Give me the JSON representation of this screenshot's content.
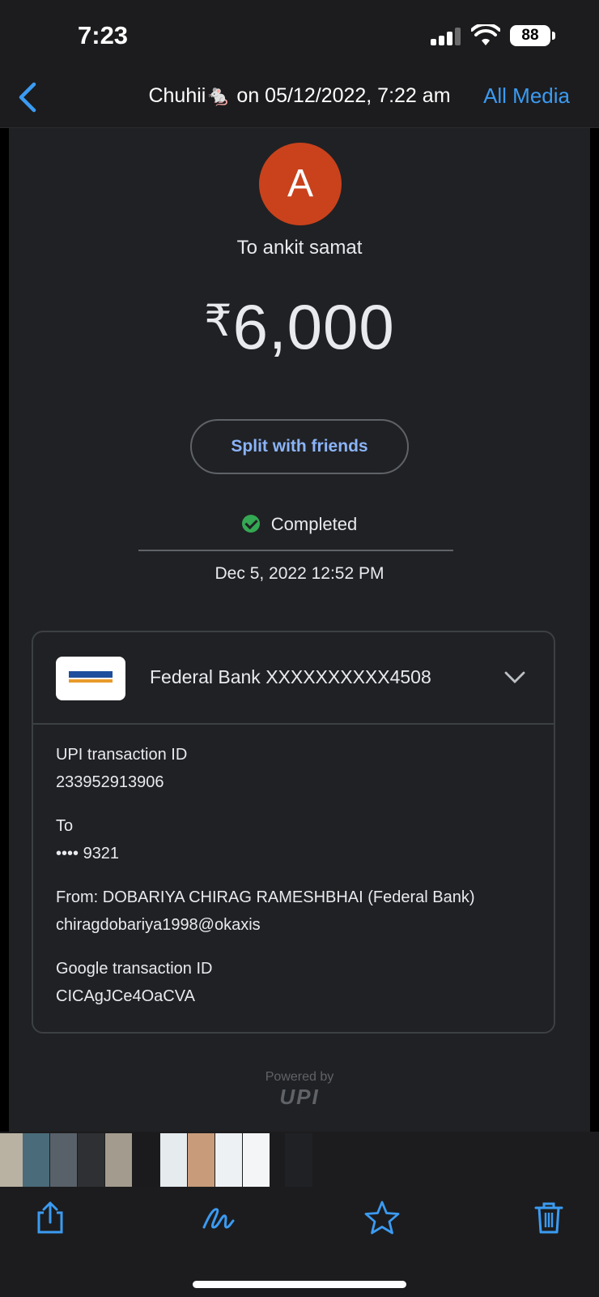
{
  "status_bar": {
    "time": "7:23",
    "battery": "88"
  },
  "nav": {
    "title": "Chuhii🐁 on 05/12/2022, 7:22 am",
    "right_action": "All Media",
    "accent": "#3b9bf2"
  },
  "payment": {
    "avatar_initial": "A",
    "avatar_color": "#c9421c",
    "to": "To ankit samat",
    "currency_symbol": "₹",
    "amount": "6,000",
    "split_button": "Split with friends",
    "status": "Completed",
    "datetime": "Dec 5, 2022 12:52 PM"
  },
  "card": {
    "bank_account": "Federal Bank XXXXXXXXXX4508",
    "details": [
      {
        "label": "UPI transaction ID",
        "value": "233952913906"
      },
      {
        "label": "To",
        "value": "•••• 9321"
      },
      {
        "label": "From: DOBARIYA CHIRAG RAMESHBHAI (Federal Bank)",
        "value": "chiragdobariya1998@okaxis"
      },
      {
        "label": "Google transaction ID",
        "value": "CICAgJCe4OaCVA"
      }
    ]
  },
  "footer": {
    "powered_by": "Powered by",
    "upi_logo": "UPI"
  },
  "toolbar": {
    "icons": [
      "share-icon",
      "markup-icon",
      "favorite-icon",
      "trash-icon"
    ]
  }
}
